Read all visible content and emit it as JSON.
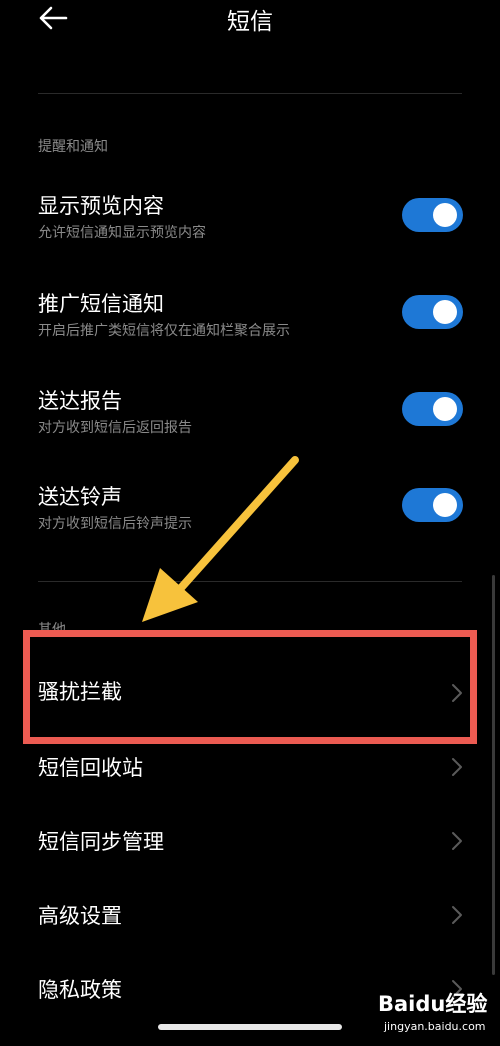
{
  "header": {
    "title": "短信"
  },
  "notifications": {
    "section_label": "提醒和通知",
    "items": [
      {
        "title": "显示预览内容",
        "subtitle": "允许短信通知显示预览内容",
        "enabled": true
      },
      {
        "title": "推广短信通知",
        "subtitle": "开启后推广类短信将仅在通知栏聚合展示",
        "enabled": true
      },
      {
        "title": "送达报告",
        "subtitle": "对方收到短信后返回报告",
        "enabled": true
      },
      {
        "title": "送达铃声",
        "subtitle": "对方收到短信后铃声提示",
        "enabled": true
      }
    ]
  },
  "other": {
    "section_label": "其他",
    "items": [
      {
        "title": "骚扰拦截"
      },
      {
        "title": "短信回收站"
      },
      {
        "title": "短信同步管理"
      },
      {
        "title": "高级设置"
      },
      {
        "title": "隐私政策"
      }
    ]
  },
  "watermark": {
    "logo": "Baidu经验",
    "url": "jingyan.baidu.com"
  },
  "colors": {
    "toggle_on": "#1e78d6",
    "highlight_border": "#ec5b52",
    "arrow": "#f7c23c"
  }
}
